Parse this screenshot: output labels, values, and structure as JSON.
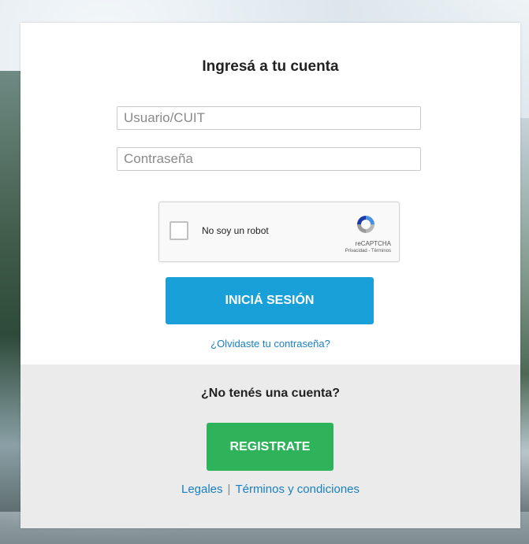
{
  "login": {
    "title": "Ingresá a tu cuenta",
    "user_placeholder": "Usuario/CUIT",
    "password_placeholder": "Contraseña",
    "recaptcha": {
      "label": "No soy un robot",
      "brand": "reCAPTCHA",
      "links": "Privacidad - Términos"
    },
    "login_button": "INICIÁ SESIÓN",
    "forgot_link": "¿Olvidaste tu contraseña?"
  },
  "register": {
    "prompt": "¿No tenés una cuenta?",
    "button": "REGISTRATE"
  },
  "footer": {
    "legal": "Legales",
    "separator": "|",
    "terms": "Términos y condiciones"
  },
  "colors": {
    "login_button": "#1aa0d8",
    "register_button": "#2fb35a",
    "link": "#1a7fc0"
  }
}
